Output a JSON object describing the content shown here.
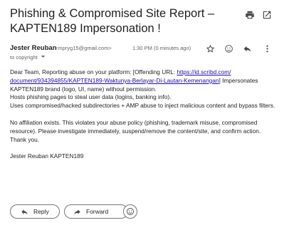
{
  "subject": "Phishing & Compromised Site Report – KAPTEN189 Impersonation !",
  "toolbar": {
    "print_icon": "print-icon",
    "popout_icon": "open-in-new-window-icon"
  },
  "sender": {
    "name": "Jester Reuban",
    "email": "<mpryg15@gmail.com>",
    "to_label": "to copyright",
    "time": "1:30 PM (0 minutes ago)"
  },
  "actions": {
    "star_icon": "star-icon",
    "emoji_icon": "emoji-reaction-icon",
    "reply_icon": "reply-icon",
    "more_icon": "more-vert-icon"
  },
  "body": {
    "line1_prefix": "Dear Team,  Reporting abuse on your platform: [Offending URL: ",
    "link_part1": "https://id.scribd.com/",
    "link_part2": "document/934394855/KAPTEN189-Waktunya-Berlayar-Di-Lautan-Kemenangan",
    "line2_suffix": "] Impersonates",
    "line3": "KAPTEN189 brand (logo, UI, name) without permission.",
    "line4": "Hosts phishing pages to steal user data (logins, banking info).",
    "line5": "Uses compromised/hacked subdirectories + AMP abuse to inject malicious content and bypass filters.",
    "line6": "No affiliation exists. This violates your abuse policy (phishing, trademark misuse, compromised resource).  Please investigate immediately, suspend/remove the content/site, and confirm action.",
    "line7": "Thank you.",
    "signature": "Jester Reuban KAPTEN189"
  },
  "buttons": {
    "reply": "Reply",
    "forward": "Forward"
  }
}
